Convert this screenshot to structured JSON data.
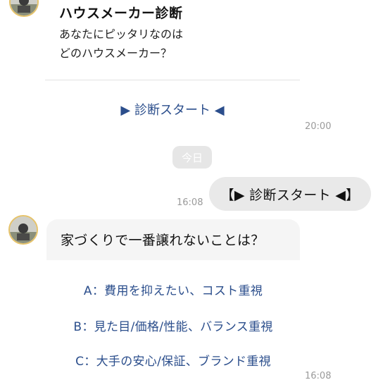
{
  "messages": {
    "card1": {
      "title": "ハウスメーカー診断",
      "body_line1": "あなたにピッタリなのは",
      "body_line2": "どのハウスメーカー？",
      "start_button": "▶ 診断スタート ◀",
      "time": "20:00"
    },
    "date_separator": "今日",
    "outgoing": {
      "text": "【▶ 診断スタート ◀】",
      "time": "16:08"
    },
    "card2": {
      "question": "家づくりで一番譲れないことは？",
      "options": [
        "A：費用を抑えたい、コスト重視",
        "B：見た目/価格/性能、バランス重視",
        "C：大手の安心/保証、ブランド重視"
      ],
      "time": "16:08"
    }
  },
  "colors": {
    "link": "#2b4e8c",
    "timestamp": "#9a9a9a",
    "outgoing_bubble": "#e9e9e9",
    "avatar_border": "#e6c36a"
  },
  "icons": {
    "avatar": "account-avatar-photo"
  }
}
